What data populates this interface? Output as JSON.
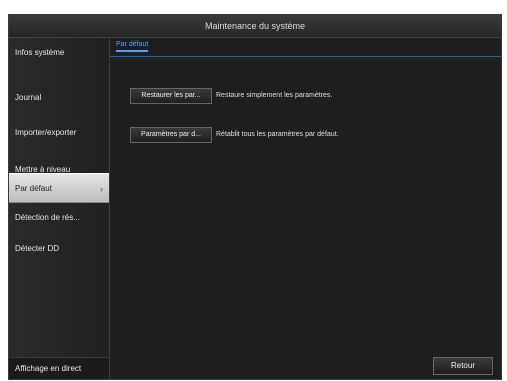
{
  "window": {
    "title": "Maintenance du système"
  },
  "sidebar": {
    "items": [
      {
        "label": "Infos système"
      },
      {
        "label": "Journal"
      },
      {
        "label": "Importer/exporter"
      },
      {
        "label": "Mettre à niveau"
      },
      {
        "label": "Par défaut",
        "chevron": "›"
      },
      {
        "label": "Détection de rés..."
      },
      {
        "label": "Détecter DD"
      }
    ],
    "bottom_label": "Affichage en direct"
  },
  "tabs": [
    {
      "label": "Par défaut"
    }
  ],
  "actions": [
    {
      "button_label": "Restaurer les par...",
      "description": "Restaure simplement les paramètres."
    },
    {
      "button_label": "Paramètres par d...",
      "description": "Rétablit tous les paramètres par défaut."
    }
  ],
  "footer": {
    "back_label": "Retour"
  },
  "colors": {
    "accent": "#4da3ff",
    "active_item_bg": "#d6d6d6",
    "window_bg": "#1f1f1f"
  }
}
